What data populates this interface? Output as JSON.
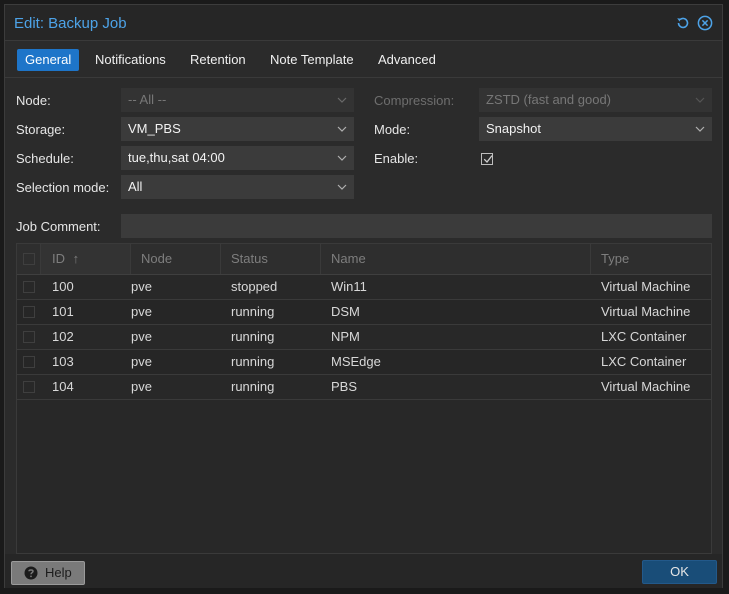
{
  "window": {
    "title": "Edit: Backup Job"
  },
  "tabs": [
    "General",
    "Notifications",
    "Retention",
    "Note Template",
    "Advanced"
  ],
  "form": {
    "node_label": "Node:",
    "node_value": "-- All --",
    "storage_label": "Storage:",
    "storage_value": "VM_PBS",
    "schedule_label": "Schedule:",
    "schedule_value": "tue,thu,sat 04:00",
    "selection_label": "Selection mode:",
    "selection_value": "All",
    "compression_label": "Compression:",
    "compression_value": "ZSTD (fast and good)",
    "mode_label": "Mode:",
    "mode_value": "Snapshot",
    "enable_label": "Enable:",
    "enable_checked": true,
    "comment_label": "Job Comment:",
    "comment_value": ""
  },
  "grid": {
    "columns": [
      "ID",
      "Node",
      "Status",
      "Name",
      "Type"
    ],
    "sort_indicator": "↑",
    "rows": [
      [
        "100",
        "pve",
        "stopped",
        "Win11",
        "Virtual Machine"
      ],
      [
        "101",
        "pve",
        "running",
        "DSM",
        "Virtual Machine"
      ],
      [
        "102",
        "pve",
        "running",
        "NPM",
        "LXC Container"
      ],
      [
        "103",
        "pve",
        "running",
        "MSEdge",
        "LXC Container"
      ],
      [
        "104",
        "pve",
        "running",
        "PBS",
        "Virtual Machine"
      ]
    ]
  },
  "footer": {
    "help_label": "Help",
    "ok_label": "OK"
  },
  "colors": {
    "accent": "#1e75c9",
    "title": "#4da3e8",
    "ok_button": "#194d78"
  },
  "icons": [
    "reset-icon",
    "close-icon",
    "chevron-down-icon",
    "checkmark-icon",
    "question-circle-icon",
    "sort-ascending-icon"
  ]
}
